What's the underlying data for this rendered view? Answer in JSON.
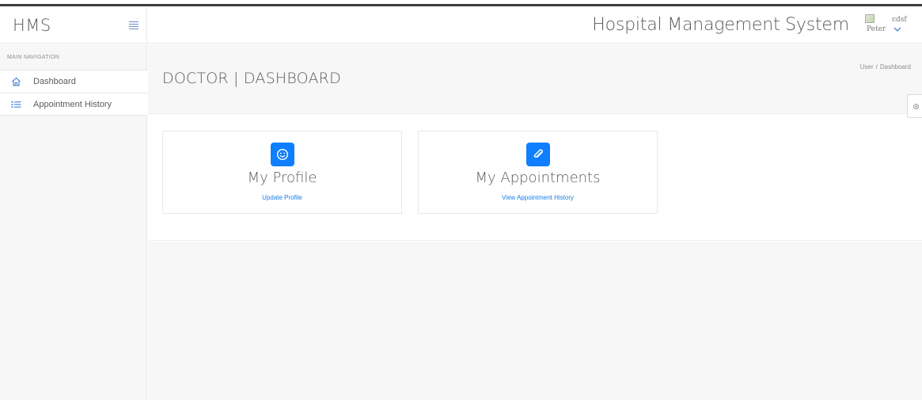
{
  "brand": {
    "name": "HMS"
  },
  "header": {
    "app_title": "Hospital Management System",
    "avatar_alt": "Peter",
    "user_name": "cdsf"
  },
  "sidebar": {
    "section_label": "MAIN NAVIGATION",
    "items": [
      {
        "label": "Dashboard",
        "icon": "home-icon"
      },
      {
        "label": "Appointment History",
        "icon": "list-icon"
      }
    ]
  },
  "page": {
    "title": "DOCTOR | DASHBOARD",
    "breadcrumb": [
      "User",
      "Dashboard"
    ]
  },
  "cards": [
    {
      "title": "My Profile",
      "link": "Update Profile",
      "icon": "smile-icon"
    },
    {
      "title": "My Appointments",
      "link": "View Appointment History",
      "icon": "paperclip-icon"
    }
  ],
  "colors": {
    "accent": "#0f7fff",
    "link": "#1a7ee8",
    "sidebar_bg": "#f7f7f8",
    "text": "#5b5b60"
  }
}
